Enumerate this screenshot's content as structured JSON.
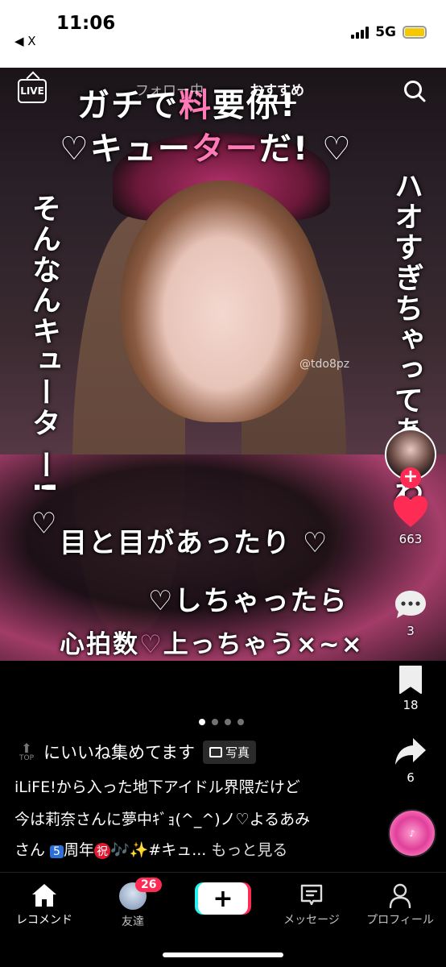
{
  "status_bar": {
    "time": "11:06",
    "back_app": "◀ X",
    "network": "5G",
    "battery_color": "#f5c800"
  },
  "top_nav": {
    "live_label": "LIVE",
    "tab_following": "フォロー中",
    "tab_recommend": "おすすめ",
    "search_icon": "search-icon"
  },
  "photo": {
    "watermark": "@tdo8pz",
    "overlay_text": {
      "line1_a": "ガチで",
      "line1_b": "料",
      "line1_c": "要你!",
      "line2_a": "♡キュー",
      "line2_b": "ター",
      "line2_c": "だ! ♡",
      "left_vertical": "そんなんキュータ ー! ♡",
      "right_vertical": "ハオすぎちゃってあわわ",
      "bottom1": "目と目があったり ♡",
      "bottom2": "♡しちゃったら",
      "bottom3_a": "心拍数",
      "bottom3_b": "♡",
      "bottom3_c": "上っちゃう×~×"
    }
  },
  "actions": {
    "likes": "663",
    "comments": "3",
    "saves": "18",
    "shares": "6",
    "accent": "#fe2c55"
  },
  "carousel": {
    "total": 4,
    "active": 0
  },
  "caption": {
    "top_label": "TOP",
    "title": "にいいね集めてます",
    "photo_tag": "写真",
    "line1": "iLiFE!から入った地下アイドル界隈だけど",
    "line2": "今は莉奈さんに夢中ｷﾞｮ(^_^)ノ♡よるあみ",
    "line3_a": "さん ",
    "line3_badge": "5",
    "line3_b": "周年",
    "line3_iwai": "祝",
    "line3_c": "🎶✨#キュ...",
    "see_more": "もっと見る"
  },
  "tabbar": {
    "home": "レコメンド",
    "friends": "友達",
    "friends_badge": "26",
    "create": "+",
    "inbox": "メッセージ",
    "profile": "プロフィール"
  }
}
